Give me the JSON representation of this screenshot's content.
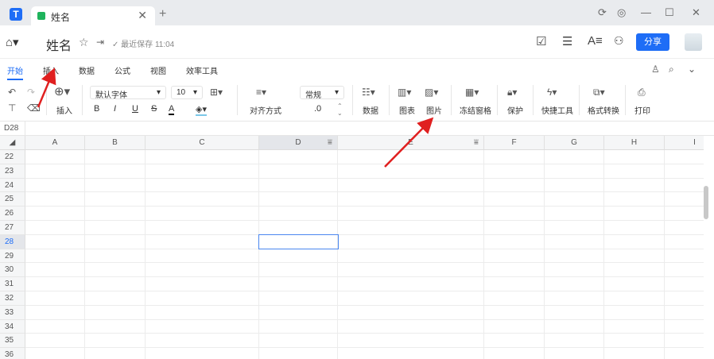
{
  "window": {
    "tab_title": "姓名",
    "close": "✕",
    "new_tab": "+",
    "controls": [
      "⟳",
      "◎",
      "—",
      "☐",
      "✕"
    ]
  },
  "header": {
    "doc_title": "姓名",
    "save_status": "最近保存 11:04",
    "share_label": "分享"
  },
  "menu_tabs": [
    {
      "label": "开始",
      "active": true
    },
    {
      "label": "插入"
    },
    {
      "label": "数据"
    },
    {
      "label": "公式"
    },
    {
      "label": "视图"
    },
    {
      "label": "效率工具"
    }
  ],
  "toolbar": {
    "insert": "插入",
    "font": "默认字体",
    "font_size": "10",
    "align": "对齐方式",
    "number_format": "常规",
    "decimal": ".0",
    "data": "数据",
    "chart": "图表",
    "picture": "图片",
    "freeze": "冻结窗格",
    "protect": "保护",
    "quick_tools": "快捷工具",
    "format_convert": "格式转换",
    "print": "打印",
    "bold": "B",
    "italic": "I",
    "underline": "U",
    "strike": "S",
    "font_color": "A"
  },
  "formula_bar": {
    "cell_ref": "D28"
  },
  "sheet": {
    "columns": [
      "A",
      "B",
      "C",
      "D",
      "E",
      "F",
      "G",
      "H",
      "I"
    ],
    "rows": [
      "22",
      "23",
      "24",
      "25",
      "26",
      "27",
      "28",
      "29",
      "30",
      "31",
      "32",
      "33",
      "34",
      "35",
      "36"
    ],
    "selected_cell": "D28"
  },
  "colors": {
    "accent": "#1e6df6",
    "arrow": "#e02020"
  }
}
